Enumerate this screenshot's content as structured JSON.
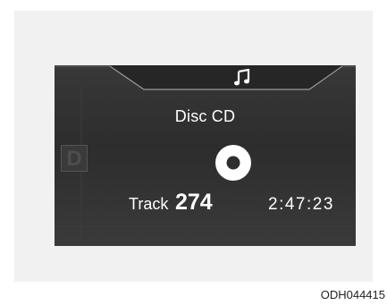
{
  "display": {
    "source_icon": "music-note-icon",
    "title": "Disc CD",
    "mode_badge": "D",
    "disc_icon": "cd-icon",
    "track_label": "Track",
    "track_number": "274",
    "play_time": "2:47:23"
  },
  "figure_code": "ODH044415",
  "colors": {
    "screen_bg": "#333333",
    "text": "#ffffff",
    "page_bg": "#f1f1f1"
  }
}
